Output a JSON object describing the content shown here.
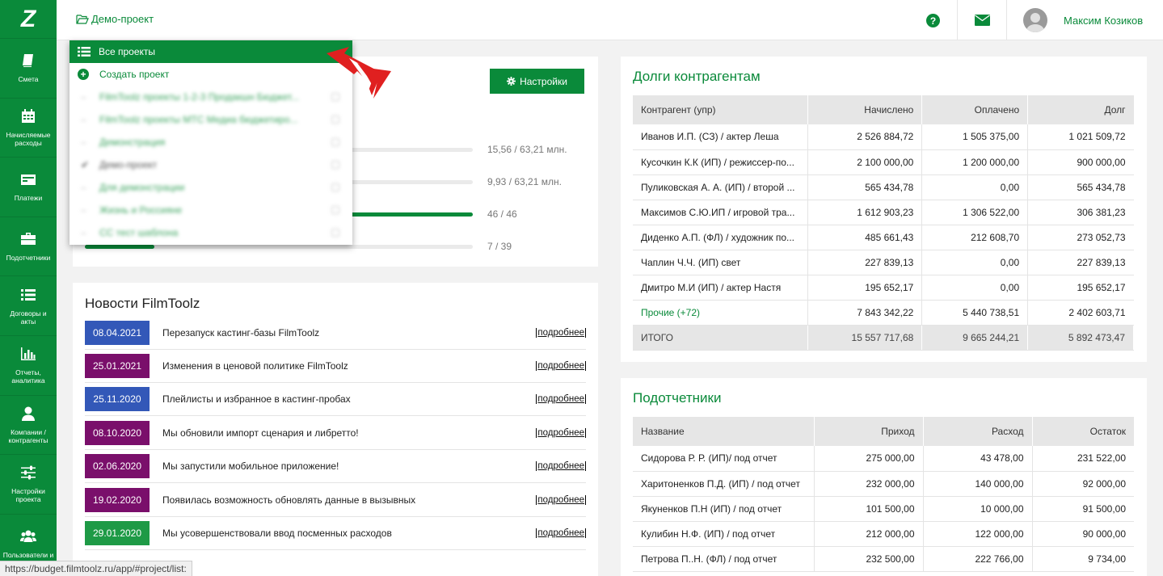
{
  "sidebar": {
    "logo": "Z",
    "items": [
      {
        "label": "Смета",
        "icon": "book-icon"
      },
      {
        "label": "Начисляемые расходы",
        "icon": "calendar-icon"
      },
      {
        "label": "Платежи",
        "icon": "card-icon"
      },
      {
        "label": "Подотчетники",
        "icon": "briefcase-icon"
      },
      {
        "label": "Договоры и акты",
        "icon": "list-icon"
      },
      {
        "label": "Отчеты, аналитика",
        "icon": "bar-chart-icon"
      },
      {
        "label": "Компании / контрагенты",
        "icon": "user-icon"
      },
      {
        "label": "Настройки проекта",
        "icon": "sliders-icon"
      },
      {
        "label": "Пользователи и",
        "icon": "users-icon"
      }
    ]
  },
  "topbar": {
    "project": "Демо-проект",
    "user_name": "Максим Козиков"
  },
  "dropdown": {
    "all_label": "Все проекты",
    "create_label": "Создать проект",
    "items": [
      "FilmToolz проекты 1-2-3 Продакшн Бюджет...",
      "FilmToolz проекты МТС Медиа бюджетиро...",
      "Демонстрация",
      "Демо-проект",
      "Для демонстрации",
      "Жизнь и Россияне",
      "СС тест шаблона"
    ]
  },
  "overview": {
    "settings_label": "Настройки",
    "progress": [
      {
        "value_text": "15,56 / 63,21 млн.",
        "fraction": 0.246
      },
      {
        "value_text": "9,93 / 63,21 млн.",
        "fraction": 0.157
      },
      {
        "value_text": "46 / 46",
        "fraction": 1.0
      },
      {
        "value_text": "7 / 39",
        "fraction": 0.179
      }
    ]
  },
  "news": {
    "title": "Новости FilmToolz",
    "more_label": "подробнее",
    "items": [
      {
        "date": "08.04.2021",
        "text": "Перезапуск кастинг-базы FilmToolz",
        "color": "#3358b8"
      },
      {
        "date": "25.01.2021",
        "text": "Изменения в ценовой политике FilmToolz",
        "color": "#7a0f6b"
      },
      {
        "date": "25.11.2020",
        "text": "Плейлисты и избранное в кастинг-пробах",
        "color": "#3358b8"
      },
      {
        "date": "08.10.2020",
        "text": "Мы обновили импорт сценария и либретто!",
        "color": "#7a0f6b"
      },
      {
        "date": "02.06.2020",
        "text": "Мы запустили мобильное приложение!",
        "color": "#7a0f6b"
      },
      {
        "date": "19.02.2020",
        "text": "Появилась возможность обновлять данные в вызывных",
        "color": "#7a0f6b"
      },
      {
        "date": "29.01.2020",
        "text": "Мы усовершенствовали ввод посменных расходов",
        "color": "#1e9a46"
      }
    ]
  },
  "debts": {
    "title": "Долги контрагентам",
    "headers": [
      "Контрагент (упр)",
      "Начислено",
      "Оплачено",
      "Долг"
    ],
    "rows": [
      [
        "Иванов И.П. (СЗ) / актер Леша",
        "2 526 884,72",
        "1 505 375,00",
        "1 021 509,72"
      ],
      [
        "Кусочкин К.К (ИП) / режиссер-по...",
        "2 100 000,00",
        "1 200 000,00",
        "900 000,00"
      ],
      [
        "Пуликовская А. А. (ИП) / второй ...",
        "565 434,78",
        "0,00",
        "565 434,78"
      ],
      [
        "Максимов С.Ю.ИП / игровой тра...",
        "1 612 903,23",
        "1 306 522,00",
        "306 381,23"
      ],
      [
        "Диденко А.П. (ФЛ) / художник по...",
        "485 661,43",
        "212 608,70",
        "273 052,73"
      ],
      [
        "Чаплин Ч.Ч. (ИП) свет",
        "227 839,13",
        "0,00",
        "227 839,13"
      ],
      [
        "Дмитро М.И (ИП) / актер Настя",
        "195 652,17",
        "0,00",
        "195 652,17"
      ]
    ],
    "other": [
      "Прочие (+72)",
      "7 843 342,22",
      "5 440 738,51",
      "2 402 603,71"
    ],
    "total": [
      "ИТОГО",
      "15 557 717,68",
      "9 665 244,21",
      "5 892 473,47"
    ]
  },
  "accountable": {
    "title": "Подотчетники",
    "headers": [
      "Название",
      "Приход",
      "Расход",
      "Остаток"
    ],
    "rows": [
      [
        "Сидорова Р. Р. (ИП)/ под отчет",
        "275 000,00",
        "43 478,00",
        "231 522,00"
      ],
      [
        "Харитоненков П.Д. (ИП) / под отчет",
        "232 000,00",
        "140 000,00",
        "92 000,00"
      ],
      [
        "Якуненков П.Н (ИП) / под отчет",
        "101 500,00",
        "10 000,00",
        "91 500,00"
      ],
      [
        "Кулибин Н.Ф. (ИП) / под отчет",
        "212 000,00",
        "122 000,00",
        "90 000,00"
      ],
      [
        "Петрова П..Н. (ФЛ) / под отчет",
        "232 500,00",
        "222 766,00",
        "9 734,00"
      ]
    ]
  },
  "status_url": "https://budget.filmtoolz.ru/app/#project/list:"
}
